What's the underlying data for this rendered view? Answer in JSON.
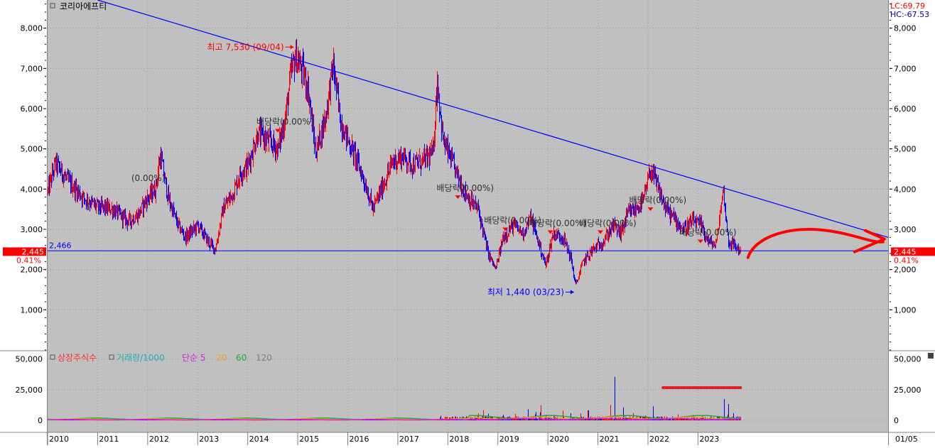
{
  "colors": {
    "panel_bg": "#c0c0c0",
    "axis_bg": "#ffffff",
    "up": "#ff0000",
    "down": "#0000ff",
    "trendline": "#0000ff",
    "support": "#0000ff",
    "price_badge": "#ff0000",
    "annotation_red": "#ff0000",
    "vol_green": "#22a83a",
    "vol_orange": "#f0a020",
    "vol_magenta": "#e020e0"
  },
  "header": {
    "title": "코리아에프티",
    "lc": "LC:69.79",
    "hc": "HC:-67.53"
  },
  "price_badge": {
    "value": "2,445",
    "change": "0.41%"
  },
  "volume_legend": {
    "items": [
      "상장주식수",
      "거래량/1000",
      "단순 5",
      "20",
      "60",
      "120"
    ],
    "colors": [
      "#ff3030",
      "#20b0b0",
      "#e020e0",
      "#f0a020",
      "#22a83a",
      "#808080"
    ]
  },
  "date_label": "01/05",
  "chart_data": [
    {
      "type": "candlestick",
      "title": "코리아에프티",
      "x_ticks": [
        "2010",
        "2011",
        "2012",
        "2013",
        "2014",
        "2015",
        "2016",
        "2017",
        "2018",
        "2019",
        "2020",
        "2021",
        "2022",
        "2023"
      ],
      "x_range": [
        2010.0,
        2026.8
      ],
      "y_ticks": [
        "1,000",
        "2,000",
        "3,000",
        "4,000",
        "5,000",
        "6,000",
        "7,000",
        "8,000"
      ],
      "ylim": [
        0,
        8700
      ],
      "price_path": [
        [
          2010.0,
          3950
        ],
        [
          2010.15,
          4650
        ],
        [
          2010.4,
          4200
        ],
        [
          2010.7,
          3800
        ],
        [
          2011.0,
          3550
        ],
        [
          2011.3,
          3500
        ],
        [
          2011.6,
          3200
        ],
        [
          2011.8,
          3350
        ],
        [
          2011.95,
          3700
        ],
        [
          2012.15,
          4000
        ],
        [
          2012.25,
          4850
        ],
        [
          2012.4,
          3800
        ],
        [
          2012.6,
          3100
        ],
        [
          2012.75,
          2800
        ],
        [
          2013.0,
          3100
        ],
        [
          2013.2,
          2700
        ],
        [
          2013.35,
          2500
        ],
        [
          2013.5,
          3500
        ],
        [
          2013.7,
          3900
        ],
        [
          2013.85,
          4400
        ],
        [
          2014.0,
          4600
        ],
        [
          2014.2,
          5400
        ],
        [
          2014.4,
          5200
        ],
        [
          2014.6,
          5000
        ],
        [
          2014.75,
          5800
        ],
        [
          2014.85,
          6800
        ],
        [
          2014.95,
          7300
        ],
        [
          2015.1,
          6900
        ],
        [
          2015.2,
          6500
        ],
        [
          2015.35,
          4900
        ],
        [
          2015.55,
          5800
        ],
        [
          2015.7,
          7100
        ],
        [
          2015.85,
          5700
        ],
        [
          2016.0,
          5200
        ],
        [
          2016.15,
          4800
        ],
        [
          2016.35,
          4100
        ],
        [
          2016.5,
          3500
        ],
        [
          2016.7,
          4100
        ],
        [
          2016.9,
          4700
        ],
        [
          2017.1,
          4800
        ],
        [
          2017.3,
          4600
        ],
        [
          2017.5,
          4700
        ],
        [
          2017.7,
          4900
        ],
        [
          2017.78,
          6700
        ],
        [
          2017.9,
          5200
        ],
        [
          2018.1,
          4600
        ],
        [
          2018.3,
          4000
        ],
        [
          2018.45,
          3700
        ],
        [
          2018.6,
          3500
        ],
        [
          2018.8,
          2400
        ],
        [
          2018.95,
          2000
        ],
        [
          2019.1,
          2800
        ],
        [
          2019.3,
          3100
        ],
        [
          2019.5,
          2900
        ],
        [
          2019.65,
          3300
        ],
        [
          2019.8,
          2700
        ],
        [
          2019.95,
          2100
        ],
        [
          2020.1,
          2900
        ],
        [
          2020.3,
          2800
        ],
        [
          2020.45,
          2300
        ],
        [
          2020.55,
          1600
        ],
        [
          2020.7,
          2200
        ],
        [
          2020.9,
          2500
        ],
        [
          2021.1,
          2700
        ],
        [
          2021.3,
          3100
        ],
        [
          2021.45,
          2900
        ],
        [
          2021.6,
          3400
        ],
        [
          2021.75,
          3500
        ],
        [
          2021.9,
          3700
        ],
        [
          2022.05,
          4500
        ],
        [
          2022.2,
          4000
        ],
        [
          2022.35,
          3500
        ],
        [
          2022.5,
          3300
        ],
        [
          2022.7,
          3000
        ],
        [
          2022.9,
          3200
        ],
        [
          2023.05,
          3100
        ],
        [
          2023.2,
          2700
        ],
        [
          2023.35,
          2600
        ],
        [
          2023.5,
          4000
        ],
        [
          2023.6,
          2700
        ],
        [
          2023.72,
          2600
        ],
        [
          2023.85,
          2445
        ]
      ],
      "trendline": [
        [
          2011.0,
          8700
        ],
        [
          2026.8,
          2800
        ]
      ],
      "support_line": {
        "value": 2466,
        "label": "2,466"
      },
      "annotations": [
        {
          "text": "최고 7,530 (09/04)",
          "x": 2014.95,
          "y": 7530,
          "color": "#ff0000",
          "side": "left"
        },
        {
          "text": "최저 1,440 (03/23)",
          "x": 2020.55,
          "y": 1440,
          "color": "#0000ff",
          "side": "left"
        },
        {
          "text": "배당락(0.00%)",
          "x": 2014.6,
          "y": 5600
        },
        {
          "text": "(0.00%)",
          "x": 2012.1,
          "y": 4200
        },
        {
          "text": "배당락(0.00%)",
          "x": 2018.2,
          "y": 3950
        },
        {
          "text": "배당락(0.00%)",
          "x": 2019.15,
          "y": 3150
        },
        {
          "text": "배당락(0.00%)",
          "x": 2020.05,
          "y": 3080
        },
        {
          "text": "배당락(0.00%)",
          "x": 2021.05,
          "y": 3080
        },
        {
          "text": "배당락(0.00%)",
          "x": 2022.05,
          "y": 3650
        },
        {
          "text": "배당락(0.00%)",
          "x": 2023.05,
          "y": 2850
        }
      ]
    },
    {
      "type": "bar",
      "title": "거래량",
      "y_ticks": [
        "0",
        "25,000",
        "50,000"
      ],
      "ylim": [
        0,
        55000
      ],
      "spikes": [
        [
          2017.85,
          5000
        ],
        [
          2018.6,
          11000
        ],
        [
          2018.7,
          15000
        ],
        [
          2018.8,
          9000
        ],
        [
          2019.1,
          6000
        ],
        [
          2019.35,
          10000
        ],
        [
          2019.6,
          9000
        ],
        [
          2019.75,
          14000
        ],
        [
          2019.85,
          23000
        ],
        [
          2019.95,
          8000
        ],
        [
          2020.3,
          12000
        ],
        [
          2020.45,
          7000
        ],
        [
          2020.65,
          6000
        ],
        [
          2020.8,
          20000
        ],
        [
          2021.25,
          16000
        ],
        [
          2021.33,
          45000
        ],
        [
          2021.5,
          14000
        ],
        [
          2021.7,
          7000
        ],
        [
          2021.95,
          9000
        ],
        [
          2022.1,
          12000
        ],
        [
          2022.25,
          6000
        ],
        [
          2022.6,
          7000
        ],
        [
          2022.9,
          8000
        ],
        [
          2023.1,
          6000
        ],
        [
          2023.4,
          7000
        ],
        [
          2023.52,
          18000
        ],
        [
          2023.6,
          22000
        ],
        [
          2023.7,
          9000
        ]
      ]
    }
  ]
}
